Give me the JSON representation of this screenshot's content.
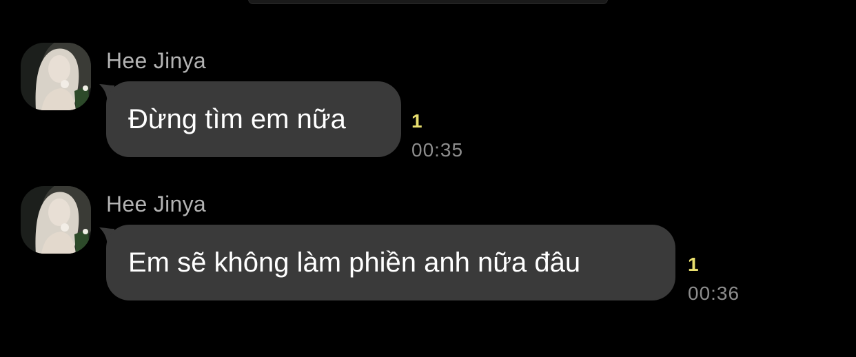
{
  "messages": [
    {
      "sender": "Hee Jinya",
      "text": "Đừng tìm em nữa",
      "unread_count": "1",
      "time": "00:35",
      "avatar_icon": "profile-photo"
    },
    {
      "sender": "Hee Jinya",
      "text": "Em sẽ không làm phiền anh nữa đâu",
      "unread_count": "1",
      "time": "00:36",
      "avatar_icon": "profile-photo"
    }
  ],
  "colors": {
    "background": "#000000",
    "bubble": "#3a3a3a",
    "sender_name": "#b3b3b3",
    "unread": "#e9df6f",
    "timestamp": "#8d8d8d"
  }
}
